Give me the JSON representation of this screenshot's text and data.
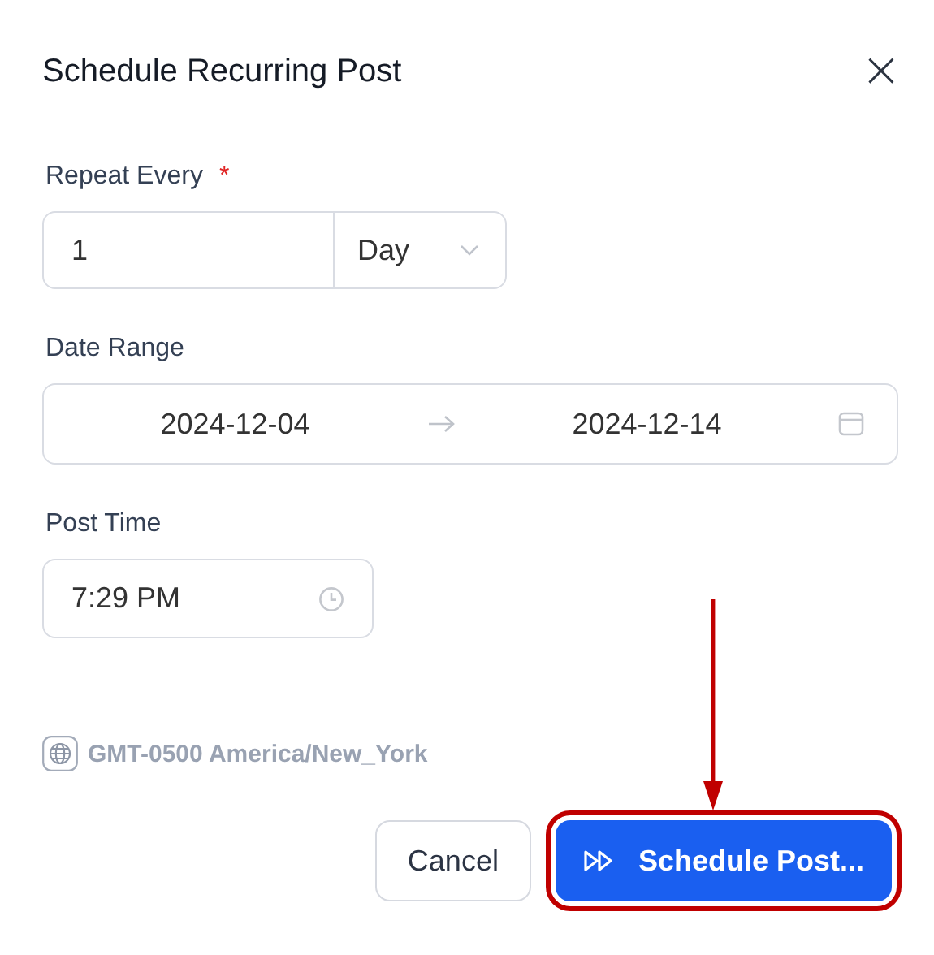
{
  "dialog": {
    "title": "Schedule Recurring Post",
    "close": "×"
  },
  "repeat_every": {
    "label": "Repeat Every",
    "required_mark": "*",
    "value": "1",
    "unit": "Day"
  },
  "date_range": {
    "label": "Date Range",
    "start": "2024-12-04",
    "end": "2024-12-14"
  },
  "post_time": {
    "label": "Post Time",
    "value": "7:29 PM"
  },
  "timezone": "GMT-0500 America/New_York",
  "buttons": [
    {
      "kind": "secondary",
      "label": "Cancel",
      "highlighted": false
    },
    {
      "kind": "primary",
      "label": "Schedule Post...",
      "highlighted": true
    }
  ]
}
